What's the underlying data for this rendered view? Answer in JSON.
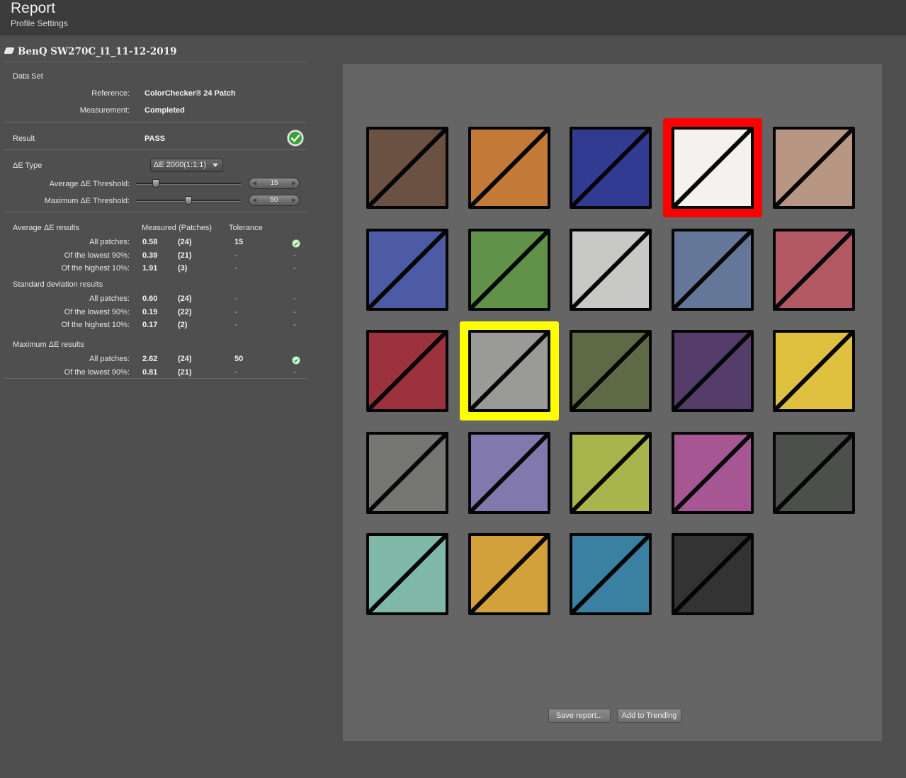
{
  "header": {
    "title": "Report",
    "subtitle": "Profile Settings"
  },
  "device": {
    "name": "BenQ SW270C_i1_11-12-2019",
    "icon": "display-icon"
  },
  "dataset": {
    "section_label": "Data Set",
    "reference_label": "Reference:",
    "reference_value": "ColorChecker® 24 Patch",
    "measurement_label": "Measurement:",
    "measurement_value": "Completed"
  },
  "result": {
    "label": "Result",
    "value": "PASS",
    "icon": "check-circle-icon"
  },
  "de_type": {
    "label": "ΔE Type",
    "selected": "ΔE 2000(1:1:1)"
  },
  "thresholds": {
    "average_label": "Average  ΔE Threshold:",
    "average_value": "15",
    "average_level": 15,
    "maximum_label": "Maximum ΔE Threshold:",
    "maximum_value": "50",
    "maximum_level": 50
  },
  "results_header": {
    "section": "Average ΔE results",
    "measured": "Measured (Patches)",
    "tolerance": "Tolerance"
  },
  "average": [
    {
      "label": "All patches:",
      "value": "0.58",
      "patches": "(24)",
      "tolerance": "15",
      "status": "ok"
    },
    {
      "label": "Of the lowest 90%:",
      "value": "0.39",
      "patches": "(21)",
      "tolerance": "-",
      "status": "-"
    },
    {
      "label": "Of the highest 10%:",
      "value": "1.91",
      "patches": "(3)",
      "tolerance": "-",
      "status": "-"
    }
  ],
  "stddev_header": "Standard deviation results",
  "stddev": [
    {
      "label": "All patches:",
      "value": "0.60",
      "patches": "(24)",
      "tolerance": "-",
      "status": "-"
    },
    {
      "label": "Of the lowest 90%:",
      "value": "0.19",
      "patches": "(22)",
      "tolerance": "-",
      "status": "-"
    },
    {
      "label": "Of the highest 10%:",
      "value": "0.17",
      "patches": "(2)",
      "tolerance": "-",
      "status": "-"
    }
  ],
  "maximum_header": "Maximum ΔE results",
  "maximum": [
    {
      "label": "All patches:",
      "value": "2.62",
      "patches": "(24)",
      "tolerance": "50",
      "status": "ok"
    },
    {
      "label": "Of the lowest 90%:",
      "value": "0.81",
      "patches": "(21)",
      "tolerance": "-",
      "status": "-"
    }
  ],
  "patches": [
    {
      "color": "#6b5142"
    },
    {
      "color": "#c47a37"
    },
    {
      "color": "#323b92"
    },
    {
      "color": "#f4f2ef",
      "highlight": "red"
    },
    {
      "color": "#b99684"
    },
    {
      "color": "#4c5ba4"
    },
    {
      "color": "#61924a"
    },
    {
      "color": "#c8c8c6"
    },
    {
      "color": "#657798"
    },
    {
      "color": "#b25862"
    },
    {
      "color": "#9c323e"
    },
    {
      "color": "#9a9a98",
      "highlight": "yellow"
    },
    {
      "color": "#5e6a44"
    },
    {
      "color": "#553d6b"
    },
    {
      "color": "#e0c13f"
    },
    {
      "color": "#767674"
    },
    {
      "color": "#8178ae"
    },
    {
      "color": "#a8b54d"
    },
    {
      "color": "#a75694"
    },
    {
      "color": "#4d4f4d"
    },
    {
      "color": "#7fb8a6"
    },
    {
      "color": "#d4a03b"
    },
    {
      "color": "#3a80a0"
    },
    {
      "color": "#333333"
    }
  ],
  "colors": {
    "highlight_red": "#ff0000",
    "highlight_yellow": "#ffff00",
    "canvas": "#656565",
    "pass_green": "#3aa03a"
  },
  "buttons": {
    "save": "Save report...",
    "trending": "Add to Trending"
  }
}
